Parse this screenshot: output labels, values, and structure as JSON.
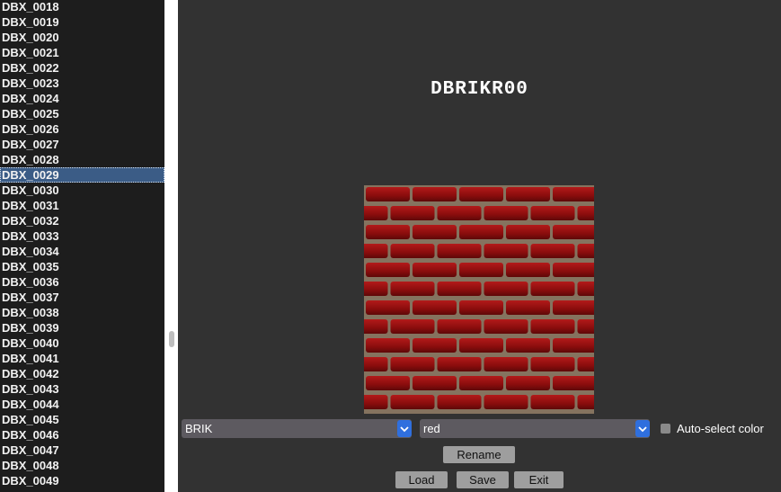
{
  "file_list": {
    "items": [
      "DBX_0018",
      "DBX_0019",
      "DBX_0020",
      "DBX_0021",
      "DBX_0022",
      "DBX_0023",
      "DBX_0024",
      "DBX_0025",
      "DBX_0026",
      "DBX_0027",
      "DBX_0028",
      "DBX_0029",
      "DBX_0030",
      "DBX_0031",
      "DBX_0032",
      "DBX_0033",
      "DBX_0034",
      "DBX_0035",
      "DBX_0036",
      "DBX_0037",
      "DBX_0038",
      "DBX_0039",
      "DBX_0040",
      "DBX_0041",
      "DBX_0042",
      "DBX_0043",
      "DBX_0044",
      "DBX_0045",
      "DBX_0046",
      "DBX_0047",
      "DBX_0048",
      "DBX_0049"
    ],
    "selected": "DBX_0029"
  },
  "preview": {
    "texture_name": "DBRIKR00",
    "description": "red brick texture",
    "colors": {
      "brick": "#8e1010",
      "mortar": "#8a7a66"
    }
  },
  "controls": {
    "texture_select_value": "BRIK",
    "color_select_value": "red",
    "auto_select_label": "Auto-select color",
    "auto_select_checked": false,
    "rename_label": "Rename",
    "load_label": "Load",
    "save_label": "Save",
    "exit_label": "Exit"
  },
  "theme": {
    "selection": "#3b5c86",
    "dropdown_accent": "#2f6fde"
  }
}
